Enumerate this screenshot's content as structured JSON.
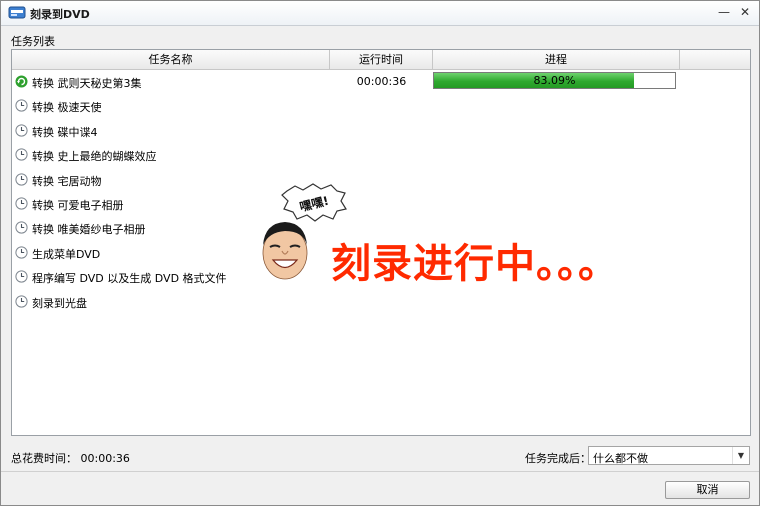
{
  "window": {
    "title": "刻录到DVD",
    "controls": {
      "minimize": "—",
      "close": "✕"
    }
  },
  "section_label": "任务列表",
  "table": {
    "columns": [
      "任务名称",
      "运行时间",
      "进程",
      ""
    ],
    "rows": [
      {
        "label": "转换 武则天秘史第3集",
        "icon": "refresh-circle-icon",
        "time": "00:00:36",
        "progress": 0.8309,
        "progress_text": "83.09%"
      },
      {
        "label": "转换 极速天使",
        "icon": "clock-icon"
      },
      {
        "label": "转换 碟中谍4",
        "icon": "clock-icon"
      },
      {
        "label": "转换 史上最绝的蝴蝶效应",
        "icon": "clock-icon"
      },
      {
        "label": "转换 宅居动物",
        "icon": "clock-icon"
      },
      {
        "label": "转换 可爱电子相册",
        "icon": "clock-icon"
      },
      {
        "label": "转换 唯美婚纱电子相册",
        "icon": "clock-icon"
      },
      {
        "label": "生成菜单DVD",
        "icon": "clock-icon"
      },
      {
        "label": "程序编写 DVD 以及生成 DVD 格式文件",
        "icon": "clock-icon"
      },
      {
        "label": "刻录到光盘",
        "icon": "clock-icon"
      }
    ]
  },
  "overlay": {
    "bubble_text": "嘿嘿!",
    "burning_text": "刻录进行中。。。",
    "accent": "#ff2a00"
  },
  "footer": {
    "total_time_label": "总花费时间：",
    "total_time_value": "00:00:36",
    "after_label": "任务完成后：",
    "after_value": "什么都不做"
  },
  "buttons": {
    "cancel": "取消"
  },
  "colors": {
    "progress_green": "#2fa92f"
  }
}
